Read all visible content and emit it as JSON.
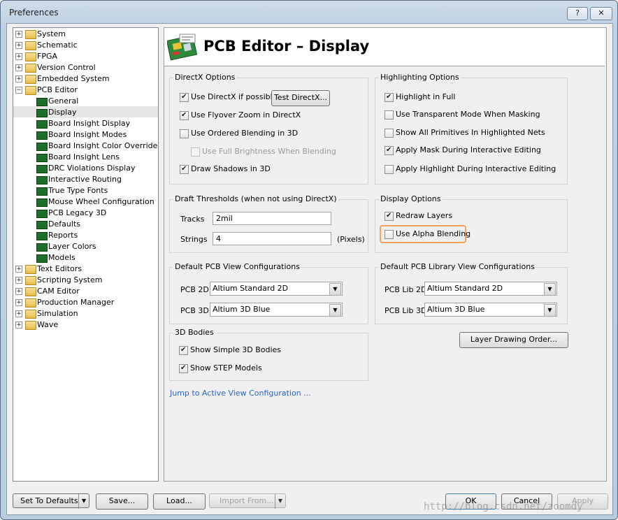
{
  "window": {
    "title": "Preferences",
    "help_label": "?",
    "close_label": "✕"
  },
  "tree": {
    "items": [
      {
        "label": "System",
        "depth": 0,
        "exp": "+"
      },
      {
        "label": "Schematic",
        "depth": 0,
        "exp": "+"
      },
      {
        "label": "FPGA",
        "depth": 0,
        "exp": "+"
      },
      {
        "label": "Version Control",
        "depth": 0,
        "exp": "+"
      },
      {
        "label": "Embedded System",
        "depth": 0,
        "exp": "+"
      },
      {
        "label": "PCB Editor",
        "depth": 0,
        "exp": "−"
      },
      {
        "label": "General",
        "depth": 1
      },
      {
        "label": "Display",
        "depth": 1,
        "selected": true
      },
      {
        "label": "Board Insight Display",
        "depth": 1
      },
      {
        "label": "Board Insight Modes",
        "depth": 1
      },
      {
        "label": "Board Insight Color Overrides",
        "depth": 1
      },
      {
        "label": "Board Insight Lens",
        "depth": 1
      },
      {
        "label": "DRC Violations Display",
        "depth": 1
      },
      {
        "label": "Interactive Routing",
        "depth": 1
      },
      {
        "label": "True Type Fonts",
        "depth": 1
      },
      {
        "label": "Mouse Wheel Configuration",
        "depth": 1
      },
      {
        "label": "PCB Legacy 3D",
        "depth": 1
      },
      {
        "label": "Defaults",
        "depth": 1
      },
      {
        "label": "Reports",
        "depth": 1
      },
      {
        "label": "Layer Colors",
        "depth": 1
      },
      {
        "label": "Models",
        "depth": 1
      },
      {
        "label": "Text Editors",
        "depth": 0,
        "exp": "+"
      },
      {
        "label": "Scripting System",
        "depth": 0,
        "exp": "+"
      },
      {
        "label": "CAM Editor",
        "depth": 0,
        "exp": "+"
      },
      {
        "label": "Production Manager",
        "depth": 0,
        "exp": "+"
      },
      {
        "label": "Simulation",
        "depth": 0,
        "exp": "+"
      },
      {
        "label": "Wave",
        "depth": 0,
        "exp": "+"
      }
    ]
  },
  "header": {
    "title": "PCB Editor – Display"
  },
  "directx": {
    "title": "DirectX Options",
    "use_directx": "Use DirectX if possible",
    "test_button": "Test DirectX...",
    "flyover": "Use Flyover Zoom in DirectX",
    "ordered": "Use Ordered Blending in 3D",
    "full_brightness": "Use Full Brightness When Blending",
    "shadows": "Draw Shadows in 3D"
  },
  "highlighting": {
    "title": "Highlighting Options",
    "full": "Highlight in Full",
    "transparent": "Use Transparent Mode When Masking",
    "all_primitives": "Show All Primitives In Highlighted Nets",
    "mask": "Apply Mask During Interactive Editing",
    "highlight": "Apply Highlight During Interactive Editing"
  },
  "draft": {
    "title": "Draft Thresholds (when not using DirectX)",
    "tracks_label": "Tracks",
    "tracks_value": "2mil",
    "strings_label": "Strings",
    "strings_value": "4",
    "units": "(Pixels)"
  },
  "display_options": {
    "title": "Display Options",
    "redraw": "Redraw Layers",
    "alpha": "Use Alpha Blending"
  },
  "view_config": {
    "title": "Default PCB View Configurations",
    "pcb2d_label": "PCB 2D",
    "pcb2d_value": "Altium Standard 2D",
    "pcb3d_label": "PCB 3D",
    "pcb3d_value": "Altium 3D Blue"
  },
  "lib_view_config": {
    "title": "Default PCB Library View Configurations",
    "lib2d_label": "PCB Lib 2D",
    "lib2d_value": "Altium Standard 2D",
    "lib3d_label": "PCB Lib 3D",
    "lib3d_value": "Altium 3D Blue"
  },
  "bodies": {
    "title": "3D Bodies",
    "simple": "Show Simple 3D Bodies",
    "step": "Show STEP Models"
  },
  "layer_order_button": "Layer Drawing Order...",
  "jump_link": "Jump to Active View Configuration ...",
  "footer": {
    "set_defaults": "Set To Defaults",
    "save": "Save...",
    "load": "Load...",
    "import": "Import From...",
    "ok": "OK",
    "cancel": "Cancel",
    "apply": "Apply"
  },
  "watermark": "http://blog.csdn.net/zoomdy",
  "colors": {
    "accent_highlight": "#f7a35c",
    "link": "#2466c6"
  }
}
